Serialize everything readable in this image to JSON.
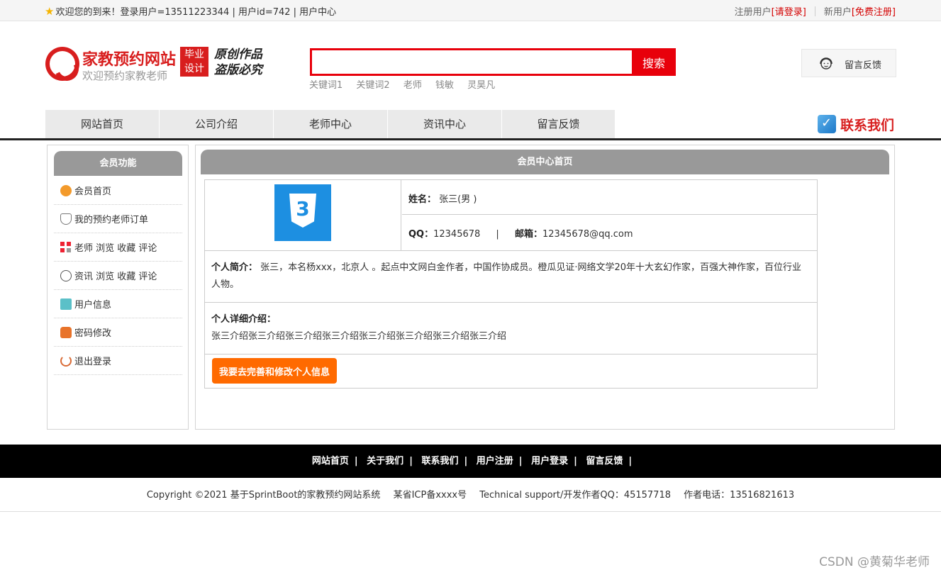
{
  "topbar": {
    "welcome": "欢迎您的到来！登录用户=13511223344 | 用户id=742 | 用户中心",
    "register_prefix": "注册用户",
    "register_link": "[请登录]",
    "newuser_prefix": "新用户",
    "newuser_link": "[免费注册]"
  },
  "logo": {
    "title": "家教预约网站",
    "subtitle": "欢迎预约家教老师",
    "badge_line1": "毕业",
    "badge_line2": "设计",
    "slogan_line1": "原创作品",
    "slogan_line2": "盗版必究"
  },
  "search": {
    "placeholder": "",
    "button": "搜索",
    "keywords": [
      "关键词1",
      "关键词2",
      "老师",
      "钱敏",
      "灵昊凡"
    ]
  },
  "feedback_box": {
    "label": "留言反馈"
  },
  "nav": {
    "items": [
      "网站首页",
      "公司介绍",
      "老师中心",
      "资讯中心",
      "留言反馈"
    ],
    "contact": "联系我们"
  },
  "sidebar": {
    "title": "会员功能",
    "items": [
      {
        "label": "会员首页",
        "icon": "home-icon"
      },
      {
        "label": "我的预约老师订单",
        "icon": "heart-icon"
      },
      {
        "label": "老师 浏览 收藏 评论",
        "icon": "grid-icon"
      },
      {
        "label": "资讯 浏览 收藏 评论",
        "icon": "clock-icon"
      },
      {
        "label": "用户信息",
        "icon": "clipboard-icon"
      },
      {
        "label": "密码修改",
        "icon": "lock-icon"
      },
      {
        "label": "退出登录",
        "icon": "power-icon"
      }
    ]
  },
  "main": {
    "title": "会员中心首页",
    "name_label": "姓名：",
    "name_value": "张三(男 )",
    "qq_label": "QQ：",
    "qq_value": "12345678",
    "divider": "|",
    "email_label": "邮箱：",
    "email_value": "12345678@qq.com",
    "intro_label": "个人简介：",
    "intro_value": "张三，本名杨xxx，北京人 。起点中文网白金作者，中国作协成员。橙瓜见证·网络文学20年十大玄幻作家，百强大神作家，百位行业人物。",
    "detail_label": "个人详细介绍：",
    "detail_value": "张三介绍张三介绍张三介绍张三介绍张三介绍张三介绍张三介绍张三介绍",
    "edit_button": "我要去完善和修改个人信息",
    "avatar_glyph": "3"
  },
  "footer": {
    "links": [
      "网站首页",
      "关于我们",
      "联系我们",
      "用户注册",
      "用户登录",
      "留言反馈"
    ],
    "separator": "|",
    "copyright": "Copyright ©2021 基于SprintBoot的家教预约网站系统",
    "icp": "某省ICP备xxxx号",
    "support": "Technical support/开发作者QQ：45157718",
    "phone": "作者电话：13516821613"
  },
  "watermark": "CSDN @黄菊华老师",
  "colors": {
    "brand_red": "#d81e1e",
    "search_red": "#e8000b",
    "button_orange": "#ff6a00",
    "panel_gray": "#999999"
  }
}
